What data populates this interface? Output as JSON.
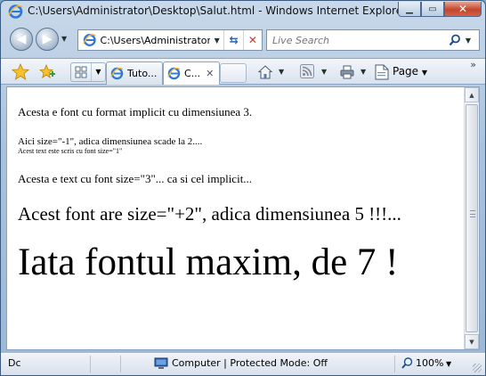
{
  "window": {
    "title": "C:\\Users\\Administrator\\Desktop\\Salut.html - Windows Internet Explorer",
    "minimize_glyph": "▁",
    "maximize_glyph": "▭",
    "close_glyph": "✕"
  },
  "address_bar": {
    "value": "C:\\Users\\Administrator\\Desktop\\Salut.html",
    "icon": "ie-page-icon"
  },
  "search": {
    "placeholder": "Live Search"
  },
  "tabs": [
    {
      "label": "Tuto...",
      "active": false
    },
    {
      "label": "C...",
      "active": true,
      "close": "✕"
    }
  ],
  "commands": {
    "page_label": "Page",
    "more": "»"
  },
  "content": {
    "lines": [
      "Acesta e font cu format implicit cu dimensiunea 3.",
      "Aici size=\"-1\", adica dimensiunea scade la 2....",
      "Acest text este scris cu font size=\"1\"",
      "Acesta e text cu font size=\"3\"... ca si cel implicit...",
      "Acest font are size=\"+2\", adica dimensiunea 5 !!!...",
      "Iata fontul maxim, de 7 !"
    ]
  },
  "status": {
    "left_text": "Dc",
    "zone_text": "Computer | Protected Mode: Off",
    "zoom": "100%"
  },
  "colors": {
    "frame": "#a9c2dc",
    "close_button": "#c2472c",
    "accent": "#2a62b8"
  }
}
